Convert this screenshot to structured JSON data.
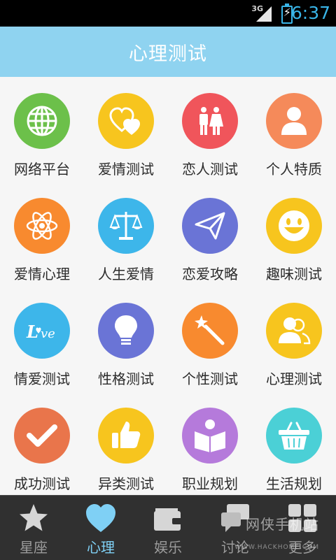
{
  "status_bar": {
    "network": "3G",
    "time": "6:37"
  },
  "header": {
    "title": "心理测试"
  },
  "items": [
    {
      "label": "网络平台",
      "color": "#6cc04a",
      "icon": "globe-icon"
    },
    {
      "label": "爱情测试",
      "color": "#f7c51e",
      "icon": "hearts-icon"
    },
    {
      "label": "恋人测试",
      "color": "#f0555b",
      "icon": "couple-icon"
    },
    {
      "label": "个人特质",
      "color": "#f58a5a",
      "icon": "person-icon"
    },
    {
      "label": "爱情心理",
      "color": "#f88a2f",
      "icon": "atom-icon"
    },
    {
      "label": "人生爱情",
      "color": "#3db6ea",
      "icon": "scales-icon"
    },
    {
      "label": "恋爱攻略",
      "color": "#6a74d6",
      "icon": "paper-plane-icon"
    },
    {
      "label": "趣味测试",
      "color": "#f7c51e",
      "icon": "smile-icon"
    },
    {
      "label": "情爱测试",
      "color": "#3db6ea",
      "icon": "love-text-icon"
    },
    {
      "label": "性格测试",
      "color": "#6a74d6",
      "icon": "lightbulb-icon"
    },
    {
      "label": "个性测试",
      "color": "#f88a2f",
      "icon": "magic-wand-icon"
    },
    {
      "label": "心理测试",
      "color": "#f7c51e",
      "icon": "users-icon"
    },
    {
      "label": "成功测试",
      "color": "#e9754b",
      "icon": "checkmark-icon"
    },
    {
      "label": "异类测试",
      "color": "#f7c51e",
      "icon": "thumbs-up-icon"
    },
    {
      "label": "职业规划",
      "color": "#b57adb",
      "icon": "book-reader-icon"
    },
    {
      "label": "生活规划",
      "color": "#4bd0d6",
      "icon": "basket-icon"
    }
  ],
  "tabs": [
    {
      "label": "星座",
      "icon": "star-icon"
    },
    {
      "label": "心理",
      "icon": "heart-icon",
      "active": true
    },
    {
      "label": "娱乐",
      "icon": "wallet-icon"
    },
    {
      "label": "讨论",
      "icon": "chat-icon"
    },
    {
      "label": "更多",
      "icon": "more-grid-icon"
    }
  ],
  "watermark": {
    "line1": "网侠手机站",
    "line2": "WWW.HACKHOME.COM"
  }
}
